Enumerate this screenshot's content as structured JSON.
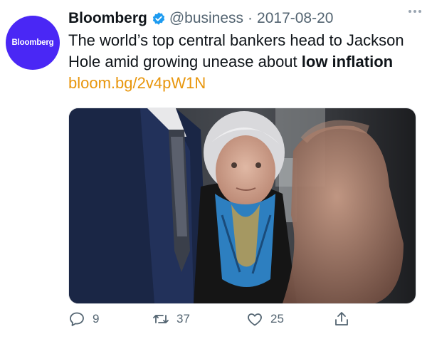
{
  "account": {
    "name": "Bloomberg",
    "handle": "@business",
    "separator": "·",
    "date": "2017-08-20",
    "avatar_text": "Bloomberg"
  },
  "tweet": {
    "text_before": "The world’s top central bankers head to Jackson Hole amid growing unease about ",
    "text_bold": "low inflation",
    "link": "bloom.bg/2v4pW1N"
  },
  "actions": {
    "reply_count": "9",
    "retweet_count": "37",
    "like_count": "25"
  },
  "colors": {
    "avatar_bg": "#4a27f5",
    "verified": "#1d9bf0",
    "link": "#e8960c",
    "muted": "#536471"
  },
  "icons": [
    "verified-badge-icon",
    "more-icon",
    "reply-icon",
    "retweet-icon",
    "like-icon",
    "share-icon"
  ]
}
